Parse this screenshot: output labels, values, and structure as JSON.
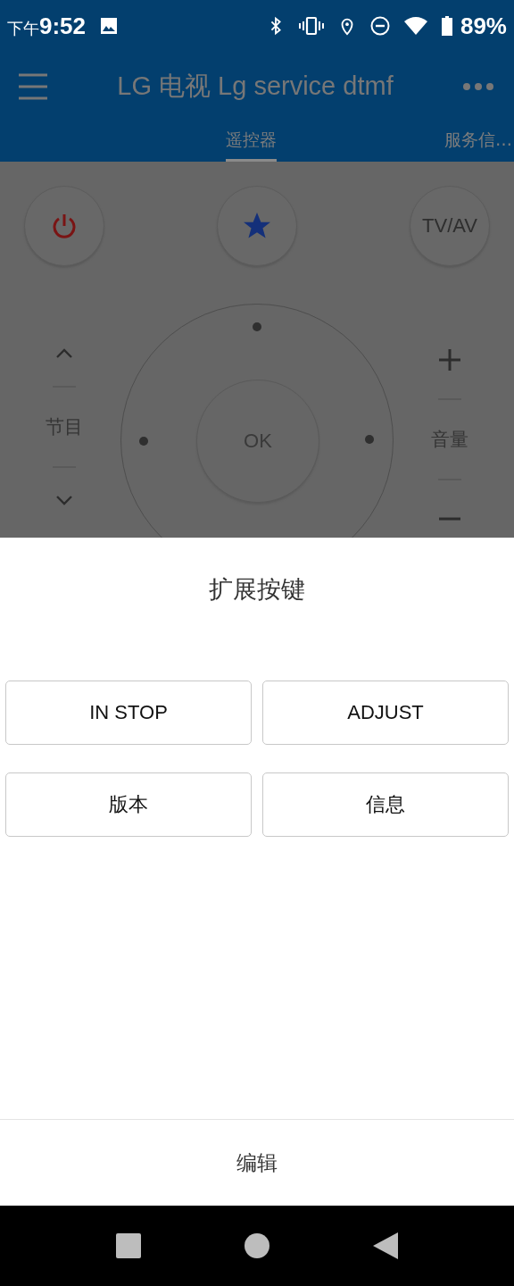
{
  "status_bar": {
    "time_prefix": "下午",
    "time": "9:52",
    "battery": "89%"
  },
  "app_bar": {
    "title": "LG 电视 Lg service dtmf"
  },
  "tabs": [
    {
      "label": "遥控器",
      "selected": true
    },
    {
      "label": "服务信…",
      "selected": false
    }
  ],
  "remote": {
    "tv_av": "TV/AV",
    "ok": "OK",
    "channel_label": "节目",
    "volume_label": "音量"
  },
  "sheet": {
    "title": "扩展按键",
    "buttons": [
      "IN STOP",
      "ADJUST",
      "版本",
      "信息"
    ],
    "edit": "编辑"
  }
}
